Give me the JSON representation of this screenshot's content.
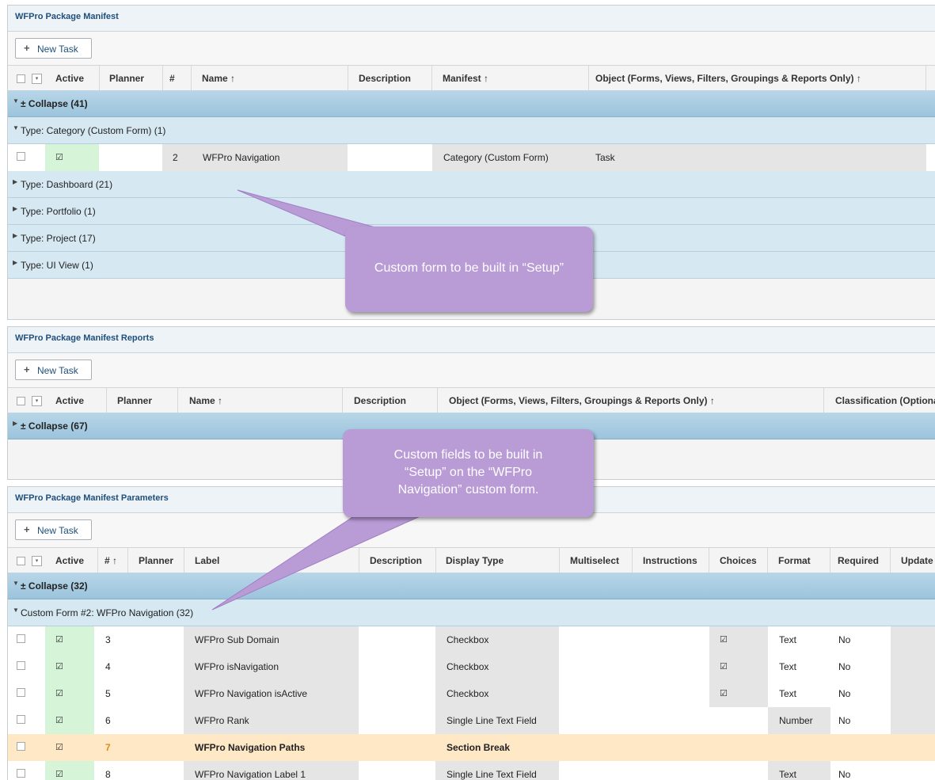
{
  "panel1": {
    "title": "WFPro Package Manifest",
    "new_task": "New Task",
    "columns": [
      "Active",
      "Planner",
      "#",
      "Name ↑",
      "Description",
      "Manifest ↑",
      "Object (Forms, Views, Filters, Groupings & Reports Only) ↑"
    ],
    "collapse": "± Collapse (41)",
    "groups": [
      "Type: Category (Custom Form) (1)",
      "Type: Dashboard (21)",
      "Type: Portfolio (1)",
      "Type: Project (17)",
      "Type: UI View (1)"
    ],
    "row": {
      "active": "☑",
      "num": "2",
      "name": "WFPro Navigation",
      "manifest": "Category (Custom Form)",
      "object": "Task"
    }
  },
  "panel2": {
    "title": "WFPro Package Manifest Reports",
    "new_task": "New Task",
    "columns": [
      "Active",
      "Planner",
      "Name ↑",
      "Description",
      "Object (Forms, Views, Filters, Groupings & Reports Only) ↑",
      "Classification (Optional)"
    ],
    "collapse": "± Collapse (67)"
  },
  "panel3": {
    "title": "WFPro Package Manifest Parameters",
    "new_task": "New Task",
    "columns": [
      "Active",
      "# ↑",
      "Planner",
      "Label",
      "Description",
      "Display Type",
      "Multiselect",
      "Instructions",
      "Choices",
      "Format",
      "Required",
      "Update"
    ],
    "collapse": "± Collapse (32)",
    "subgroup": "Custom Form #2: WFPro Navigation (32)",
    "rows": [
      {
        "num": "3",
        "label": "WFPro Sub Domain",
        "type": "Checkbox",
        "choices": "☑",
        "format": "Text",
        "required": "No"
      },
      {
        "num": "4",
        "label": "WFPro isNavigation",
        "type": "Checkbox",
        "choices": "☑",
        "format": "Text",
        "required": "No"
      },
      {
        "num": "5",
        "label": "WFPro Navigation isActive",
        "type": "Checkbox",
        "choices": "☑",
        "format": "Text",
        "required": "No"
      },
      {
        "num": "6",
        "label": "WFPro Rank",
        "type": "Single Line Text Field",
        "choices": "",
        "format": "Number",
        "required": "No"
      },
      {
        "num": "7",
        "label": "WFPro Navigation Paths",
        "type": "Section Break",
        "choices": "",
        "format": "",
        "required": ""
      },
      {
        "num": "8",
        "label": "WFPro Navigation Label 1",
        "type": "Single Line Text Field",
        "choices": "",
        "format": "Text",
        "required": "No"
      }
    ]
  },
  "callouts": {
    "c1": "Custom form to be built in “Setup”",
    "c2": "Custom fields to be built in “Setup” on the “WFPro Navigation” custom form."
  },
  "colors": {
    "group_bar": "#9bc4dc",
    "active_green": "#d6f4d8",
    "highlight": "#ffe8c6",
    "callout": "#b99bd6",
    "title_blue": "#1f4f7a"
  }
}
